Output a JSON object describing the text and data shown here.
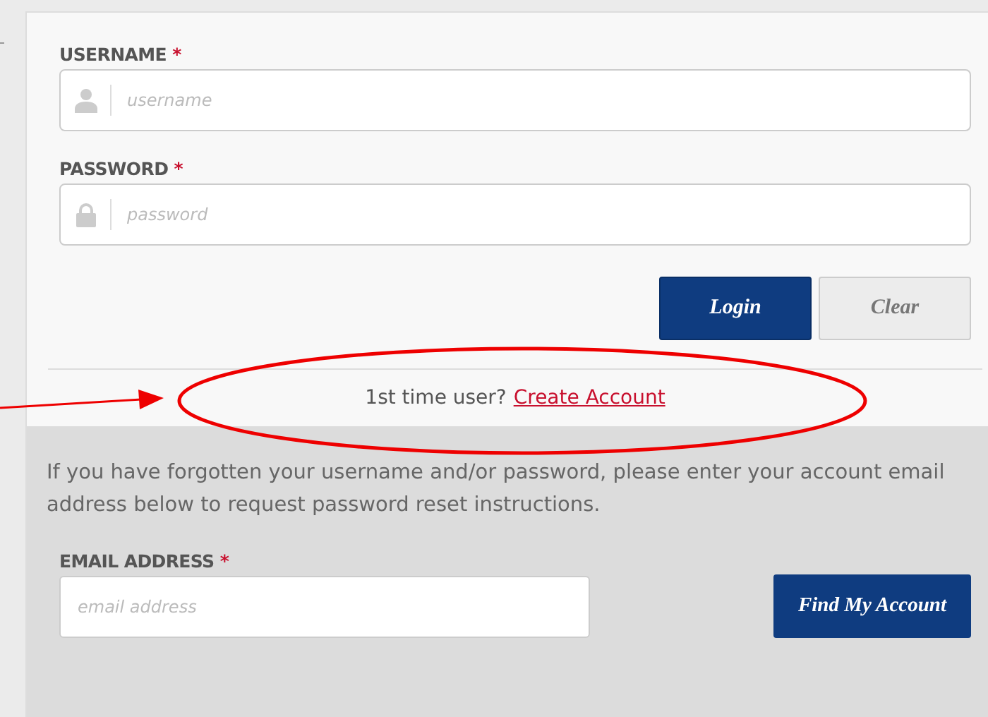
{
  "login_form": {
    "fields": [
      {
        "label": "USERNAME",
        "required_mark": "*",
        "placeholder": "username",
        "kind": "user"
      },
      {
        "label": "PASSWORD",
        "required_mark": "*",
        "placeholder": "password",
        "kind": "lock"
      }
    ],
    "buttons": [
      {
        "label": "Login",
        "kind": "primary"
      },
      {
        "label": "Clear",
        "kind": "secondary"
      }
    ],
    "signup_prompt": "1st time user?",
    "signup_link": "Create Account"
  },
  "recovery": {
    "instructions": "If you have forgotten your username and/or password, please enter your account email address below to request password reset instructions.",
    "email_field": {
      "label": "EMAIL ADDRESS",
      "required_mark": "*",
      "placeholder": "email address"
    },
    "button": "Find My Account"
  }
}
